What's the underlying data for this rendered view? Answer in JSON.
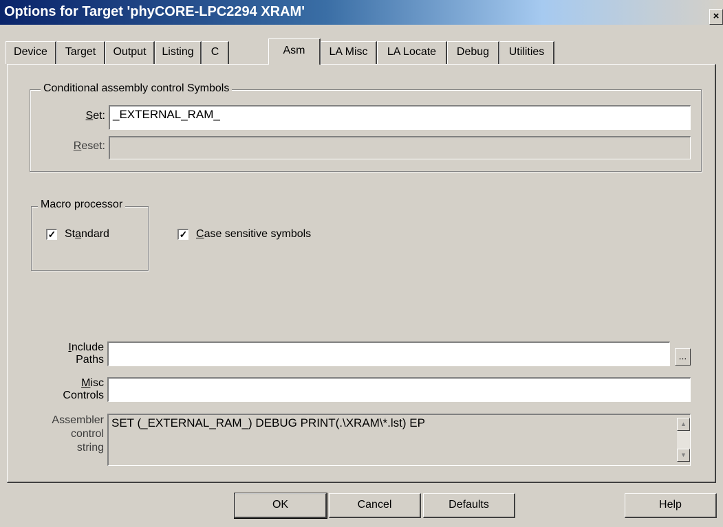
{
  "window": {
    "title": "Options for Target 'phyCORE-LPC2294 XRAM'",
    "close": "×"
  },
  "tabs": [
    "Device",
    "Target",
    "Output",
    "Listing",
    "C",
    "Asm",
    "LA Misc",
    "LA Locate",
    "Debug",
    "Utilities"
  ],
  "active_tab": "Asm",
  "conditional": {
    "legend": "Conditional assembly control Symbols",
    "set_label": "Set:",
    "set_value": "_EXTERNAL_RAM_",
    "reset_label": "Reset:",
    "reset_value": ""
  },
  "macro": {
    "legend": "Macro processor",
    "standard_label": "Standard",
    "standard_checked": true,
    "case_label": "Case sensitive symbols",
    "case_checked": true
  },
  "include_paths": {
    "label_line1": "Include",
    "label_line2": "Paths",
    "value": "",
    "browse_label": "..."
  },
  "misc_controls": {
    "label_line1": "Misc",
    "label_line2": "Controls",
    "value": ""
  },
  "assembler_string": {
    "label_line1": "Assembler",
    "label_line2": "control",
    "label_line3": "string",
    "value": "SET (_EXTERNAL_RAM_) DEBUG PRINT(.\\XRAM\\*.lst) EP"
  },
  "buttons": {
    "ok": "OK",
    "cancel": "Cancel",
    "defaults": "Defaults",
    "help": "Help"
  },
  "colors": {
    "face": "#d4d0c8",
    "title_start": "#0a246a",
    "title_end": "#a6caf0"
  }
}
